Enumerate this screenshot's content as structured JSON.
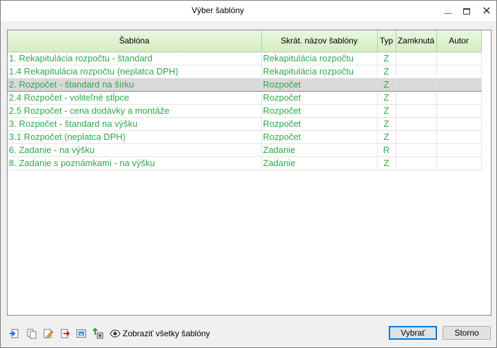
{
  "window": {
    "title": "Výber šablóny"
  },
  "table": {
    "columns": [
      "Šablóna",
      "Skrát. názov šablóny",
      "Typ",
      "Zamknutá",
      "Autor"
    ],
    "rows": [
      {
        "name": "1. Rekapitulácia rozpočtu - štandard",
        "short": "Rekapitulácia rozpočtu",
        "type": "Z",
        "locked": "",
        "author": ""
      },
      {
        "name": "1.4 Rekapitulácia rozpočtu (neplatca DPH)",
        "short": "Rekapitulácia rozpočtu",
        "type": "Z",
        "locked": "",
        "author": ""
      },
      {
        "name": "2. Rozpočet - štandard na šírku",
        "short": "Rozpočet",
        "type": "Z",
        "locked": "",
        "author": ""
      },
      {
        "name": "2.4 Rozpočet - voliteľné stĺpce",
        "short": "Rozpočet",
        "type": "Z",
        "locked": "",
        "author": ""
      },
      {
        "name": "2.5 Rozpočet - cena dodávky a montáže",
        "short": "Rozpočet",
        "type": "Z",
        "locked": "",
        "author": ""
      },
      {
        "name": "3. Rozpočet - štandard na výšku",
        "short": "Rozpočet",
        "type": "Z",
        "locked": "",
        "author": ""
      },
      {
        "name": "3.1 Rozpočet (neplatca DPH)",
        "short": "Rozpočet",
        "type": "Z",
        "locked": "",
        "author": ""
      },
      {
        "name": "6. Zadanie - na výšku",
        "short": "Zadanie",
        "type": "R",
        "locked": "",
        "author": ""
      },
      {
        "name": "8. Zadanie s poznámkami - na výšku",
        "short": "Zadanie",
        "type": "Z",
        "locked": "",
        "author": ""
      }
    ],
    "selected_row": 2
  },
  "footer": {
    "show_all_label": "Zobraziť všetky šablóny",
    "ok_label": "Vybrať",
    "cancel_label": "Storno",
    "toolbar_icons": [
      "import-icon",
      "copy-icon",
      "edit-icon",
      "delete-icon",
      "export-icon",
      "upload-icon"
    ]
  },
  "colors": {
    "row_text": "#2ea84a",
    "header_bg": "#d5eec2",
    "selection": "#d9d9d9"
  }
}
